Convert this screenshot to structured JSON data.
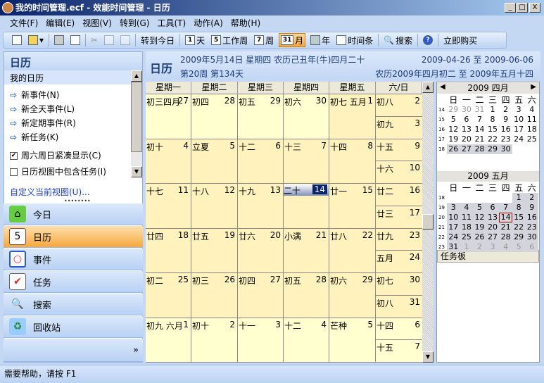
{
  "window": {
    "title": "我的时间管理.ecf - 效能时间管理 - 日历",
    "min": "_",
    "max": "□",
    "close": "X"
  },
  "menu": [
    "文件(F)",
    "编辑(E)",
    "视图(V)",
    "转到(G)",
    "工具(T)",
    "动作(A)",
    "帮助(H)"
  ],
  "toolbar": {
    "goto_today": "转到今日",
    "day_icon": "1",
    "day": "天",
    "workweek_icon": "5",
    "workweek": "工作周",
    "week_icon": "7",
    "week": "周",
    "month_icon": "31",
    "month": "月",
    "year": "年",
    "timeline": "时间条",
    "search": "搜索",
    "buy": "立即购买"
  },
  "left": {
    "title": "日历",
    "section": "我的日历",
    "actions": [
      "新事件(N)",
      "新全天事件(L)",
      "新定期事件(R)",
      "新任务(K)"
    ],
    "options": [
      {
        "label": "周六周日紧凑显示(C)",
        "checked": true
      },
      {
        "label": "日历视图中包含任务(I)",
        "checked": false
      }
    ],
    "customize": "自定义当前视图(U)...",
    "nav": [
      {
        "label": "今日",
        "icon": "home-icon"
      },
      {
        "label": "日历",
        "icon": "calendar-icon",
        "active": true
      },
      {
        "label": "事件",
        "icon": "event-icon"
      },
      {
        "label": "任务",
        "icon": "task-icon"
      },
      {
        "label": "搜索",
        "icon": "search-icon"
      },
      {
        "label": "回收站",
        "icon": "recycle-icon"
      }
    ]
  },
  "header": {
    "title": "日历",
    "date": "2009年5月14日 星期四 农历己丑年(牛)四月二十",
    "week": "第20周 第134天",
    "range": "2009-04-26 至 2009-06-06",
    "lunar_range": "农历2009年四月初二 至 2009年五月十四"
  },
  "calendar": {
    "columns": [
      "星期一",
      "星期二",
      "星期三",
      "星期四",
      "星期五",
      "六/日"
    ],
    "weeks": [
      [
        {
          "l": "初三四月",
          "d": "27",
          "o": true
        },
        {
          "l": "初四",
          "d": "28",
          "o": true
        },
        {
          "l": "初五",
          "d": "29",
          "o": true
        },
        {
          "l": "初六",
          "d": "30",
          "o": true
        },
        {
          "l": "初七 五月",
          "d": "1"
        },
        {
          "l": "初八",
          "d": "2"
        },
        {
          "l": "初九",
          "d": "3"
        }
      ],
      [
        {
          "l": "初十",
          "d": "4"
        },
        {
          "l": "立夏",
          "d": "5"
        },
        {
          "l": "十二",
          "d": "6"
        },
        {
          "l": "十三",
          "d": "7"
        },
        {
          "l": "十四",
          "d": "8"
        },
        {
          "l": "十五",
          "d": "9"
        },
        {
          "l": "十六",
          "d": "10"
        }
      ],
      [
        {
          "l": "十七",
          "d": "11"
        },
        {
          "l": "十八",
          "d": "12"
        },
        {
          "l": "十九",
          "d": "13"
        },
        {
          "l": "二十",
          "d": "14",
          "today": true
        },
        {
          "l": "廿一",
          "d": "15"
        },
        {
          "l": "廿二",
          "d": "16"
        },
        {
          "l": "廿三",
          "d": "17"
        }
      ],
      [
        {
          "l": "廿四",
          "d": "18"
        },
        {
          "l": "廿五",
          "d": "19"
        },
        {
          "l": "廿六",
          "d": "20"
        },
        {
          "l": "小满",
          "d": "21"
        },
        {
          "l": "廿八",
          "d": "22"
        },
        {
          "l": "廿九",
          "d": "23"
        },
        {
          "l": "五月",
          "d": "24"
        }
      ],
      [
        {
          "l": "初二",
          "d": "25"
        },
        {
          "l": "初三",
          "d": "26"
        },
        {
          "l": "初四",
          "d": "27"
        },
        {
          "l": "初五",
          "d": "28"
        },
        {
          "l": "初六",
          "d": "29"
        },
        {
          "l": "初七",
          "d": "30"
        },
        {
          "l": "初八",
          "d": "31"
        }
      ],
      [
        {
          "l": "初九 六月",
          "d": "1",
          "o": true
        },
        {
          "l": "初十",
          "d": "2",
          "o": true
        },
        {
          "l": "十一",
          "d": "3",
          "o": true
        },
        {
          "l": "十二",
          "d": "4",
          "o": true
        },
        {
          "l": "芒种",
          "d": "5",
          "o": true
        },
        {
          "l": "十四",
          "d": "6",
          "o": true
        },
        {
          "l": "十五",
          "d": "7",
          "o": true
        }
      ]
    ]
  },
  "mini": {
    "dow": [
      "日",
      "一",
      "二",
      "三",
      "四",
      "五",
      "六"
    ],
    "months": [
      {
        "title": "2009 四月",
        "weeks": [
          "14",
          "15",
          "16",
          "17",
          "18"
        ],
        "days": [
          [
            "29",
            "30",
            "31",
            "1",
            "2",
            "3",
            "4"
          ],
          [
            "5",
            "6",
            "7",
            "8",
            "9",
            "10",
            "11"
          ],
          [
            "12",
            "13",
            "14",
            "15",
            "16",
            "17",
            "18"
          ],
          [
            "19",
            "20",
            "21",
            "22",
            "23",
            "24",
            "25"
          ],
          [
            "26",
            "27",
            "28",
            "29",
            "30",
            "",
            ""
          ]
        ],
        "gray_first": 3,
        "sel_row": 4
      },
      {
        "title": "2009 五月",
        "weeks": [
          "18",
          "19",
          "20",
          "21",
          "22",
          "23"
        ],
        "days": [
          [
            "",
            "",
            "",
            "",
            "",
            "1",
            "2"
          ],
          [
            "3",
            "4",
            "5",
            "6",
            "7",
            "8",
            "9"
          ],
          [
            "10",
            "11",
            "12",
            "13",
            "14",
            "15",
            "16"
          ],
          [
            "17",
            "18",
            "19",
            "20",
            "21",
            "22",
            "23"
          ],
          [
            "24",
            "25",
            "26",
            "27",
            "28",
            "29",
            "30"
          ],
          [
            "31",
            "1",
            "2",
            "3",
            "4",
            "5",
            "6"
          ]
        ],
        "today": "14"
      }
    ]
  },
  "taskboard": "任务板",
  "status": "需要帮助，请按 F1"
}
